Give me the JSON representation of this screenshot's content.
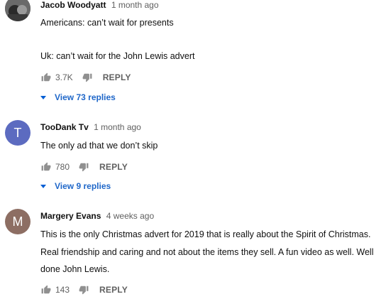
{
  "comments": [
    {
      "author": "Jacob Woodyatt",
      "time": "1 month ago",
      "avatar_letter": "",
      "avatar_color": "#4a4a4a",
      "lines": [
        "Americans: can’t wait for presents",
        "",
        "Uk: can’t wait for the John Lewis advert"
      ],
      "likes": "3.7K",
      "reply_label": "REPLY",
      "view_replies": "View 73 replies"
    },
    {
      "author": "TooDank Tv",
      "time": "1 month ago",
      "avatar_letter": "T",
      "avatar_color": "#5c6bc0",
      "lines": [
        "The only ad that we don’t skip"
      ],
      "likes": "780",
      "reply_label": "REPLY",
      "view_replies": "View 9 replies"
    },
    {
      "author": "Margery Evans",
      "time": "4 weeks ago",
      "avatar_letter": "M",
      "avatar_color": "#8d6e63",
      "lines": [
        "This is the only Christmas advert for 2019 that is really about the Spirit of Christmas.",
        "Real friendship and caring and not about the items they sell.  A fun video as well.  Well",
        "done John Lewis."
      ],
      "likes": "143",
      "reply_label": "REPLY",
      "view_replies": ""
    }
  ],
  "colors": {
    "link_blue": "#065fd4",
    "secondary_text": "#606060"
  },
  "icons": {
    "like": "thumb-up-icon",
    "dislike": "thumb-down-icon",
    "expand": "caret-down-icon"
  }
}
